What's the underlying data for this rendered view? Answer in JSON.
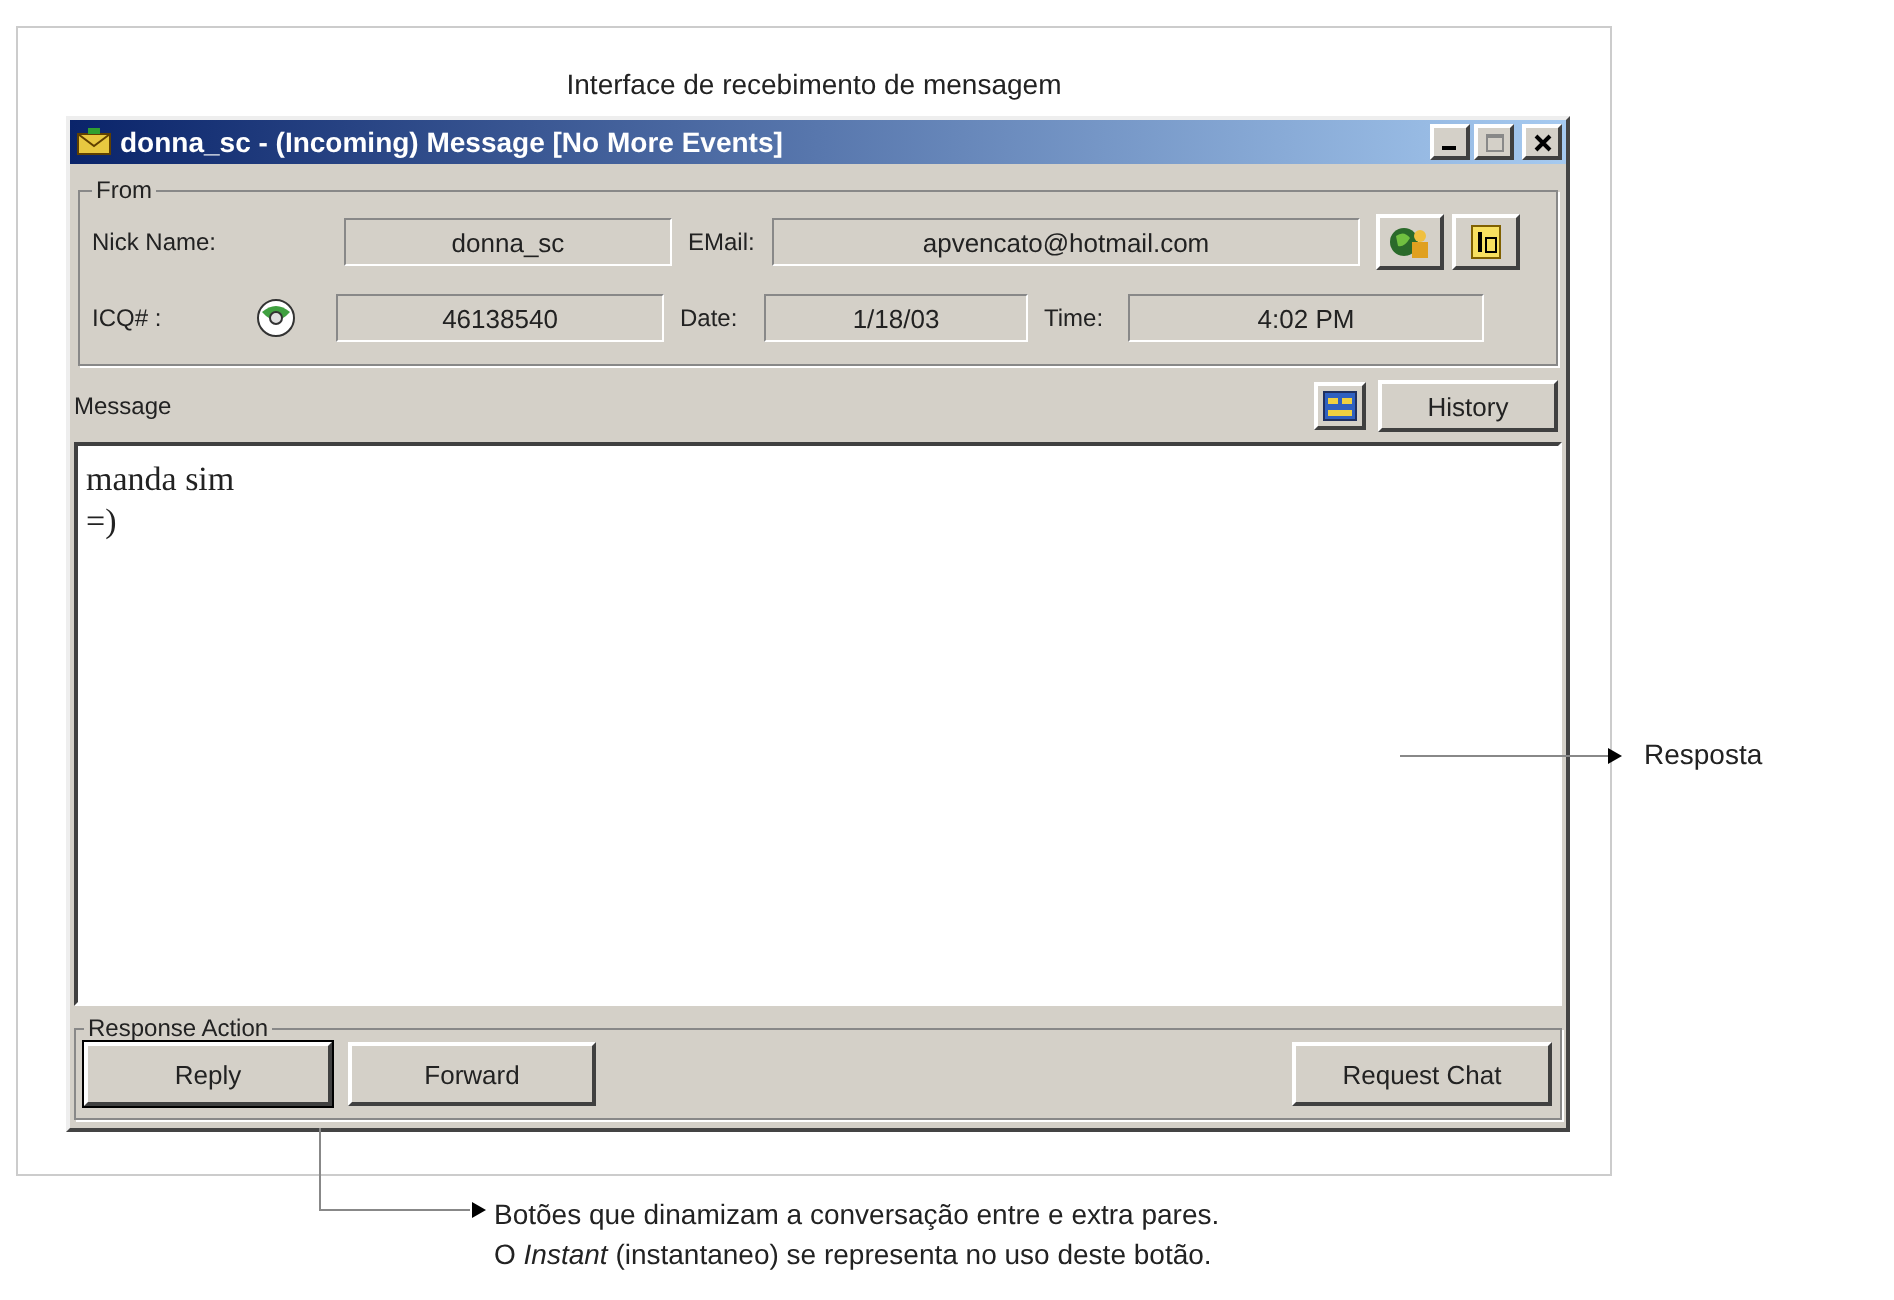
{
  "caption": "Interface de recebimento de mensagem",
  "window": {
    "title": "donna_sc - (Incoming) Message [No More Events]"
  },
  "from": {
    "legend": "From",
    "nick_label": "Nick Name:",
    "nick": "donna_sc",
    "email_label": "EMail:",
    "email": "apvencato@hotmail.com",
    "icq_label": "ICQ# :",
    "icq": "46138540",
    "date_label": "Date:",
    "date": "1/18/03",
    "time_label": "Time:",
    "time": "4:02 PM"
  },
  "message": {
    "label": "Message",
    "history_button": "History",
    "lines": [
      "manda sim",
      "=)"
    ]
  },
  "response": {
    "legend": "Response Action",
    "left_buttons": [
      {
        "label": "Reply",
        "default": true
      },
      {
        "label": "Forward",
        "default": false
      }
    ],
    "right_buttons": [
      {
        "label": "Request Chat",
        "default": false
      }
    ]
  },
  "annotations": {
    "reply_area": "Resposta",
    "buttons_note": [
      "Botões que dinamizam a conversação entre e extra pares.",
      "O *Instant* (instantaneo) se representa no uso deste botão."
    ]
  }
}
